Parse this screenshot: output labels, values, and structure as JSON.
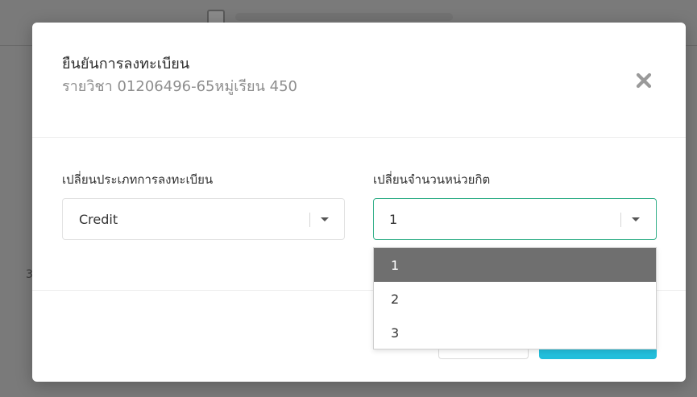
{
  "background": {
    "row_number": "3"
  },
  "modal": {
    "title": "ยืนยันการลงทะเบียน",
    "subtitle": "รายวิชา 01206496-65หมู่เรียน 450",
    "close_icon": "close-icon"
  },
  "form": {
    "registration_type": {
      "label": "เปลี่ยนประเภทการลงทะเบียน",
      "value": "Credit"
    },
    "credit_units": {
      "label": "เปลี่ยนจำนวนหน่วยกิต",
      "value": "1",
      "options": [
        "1",
        "2",
        "3"
      ],
      "selected_index": 0
    }
  },
  "colors": {
    "accent_border": "#35b08a",
    "primary_button": "#22bedb",
    "selected_option_bg": "#6f6f6f"
  }
}
